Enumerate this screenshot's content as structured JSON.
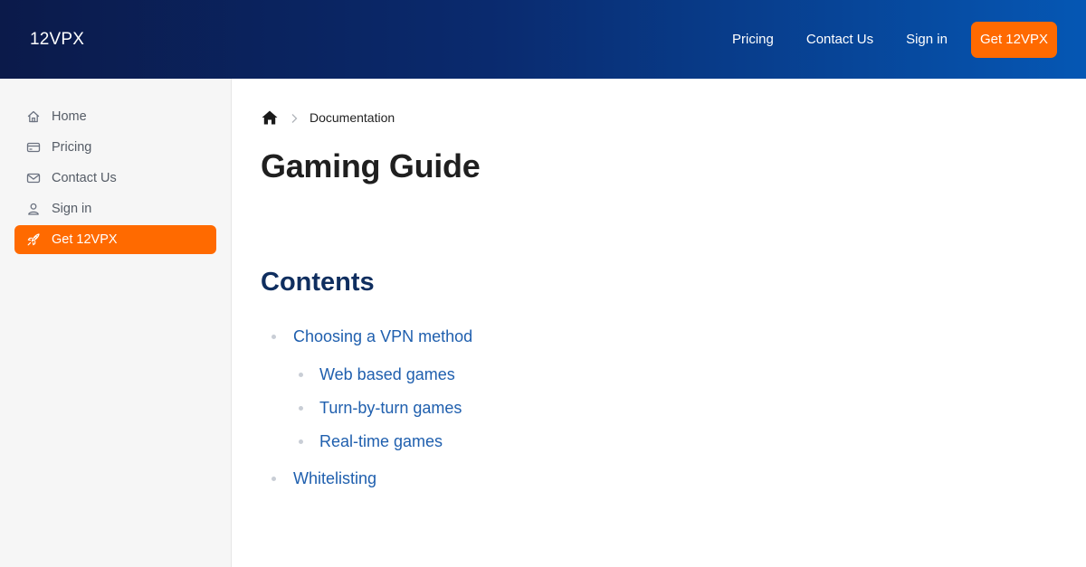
{
  "header": {
    "brand": "12VPX",
    "nav": [
      "Pricing",
      "Contact Us",
      "Sign in"
    ],
    "cta": "Get 12VPX"
  },
  "sidebar": {
    "items": [
      {
        "label": "Home",
        "icon": "home-icon"
      },
      {
        "label": "Pricing",
        "icon": "credit-card-icon"
      },
      {
        "label": "Contact Us",
        "icon": "mail-icon"
      },
      {
        "label": "Sign in",
        "icon": "user-icon"
      },
      {
        "label": "Get 12VPX",
        "icon": "rocket-icon",
        "active": true
      }
    ]
  },
  "main": {
    "breadcrumb": {
      "current": "Documentation"
    },
    "title": "Gaming Guide",
    "contents_heading": "Contents",
    "toc": [
      {
        "label": "Choosing a VPN method",
        "children": [
          {
            "label": "Web based games"
          },
          {
            "label": "Turn-by-turn games"
          },
          {
            "label": "Real-time games"
          }
        ]
      },
      {
        "label": "Whitelisting"
      }
    ]
  },
  "colors": {
    "accent": "#ff6a00",
    "header_gradient_start": "#0b1a4a",
    "header_gradient_end": "#0557b4",
    "link": "#1f5fae",
    "heading": "#0f2e5f"
  }
}
